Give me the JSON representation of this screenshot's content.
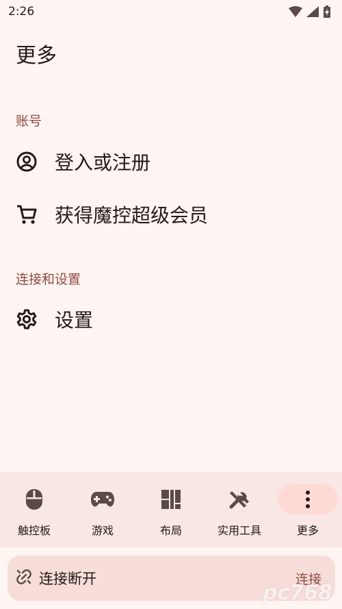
{
  "status_bar": {
    "time": "2:26"
  },
  "page": {
    "title": "更多"
  },
  "sections": {
    "account": {
      "header": "账号",
      "items": [
        {
          "label": "登入或注册",
          "icon": "account-circle-icon"
        },
        {
          "label": "获得魔控超级会员",
          "icon": "cart-icon"
        }
      ]
    },
    "connection": {
      "header": "连接和设置",
      "items": [
        {
          "label": "设置",
          "icon": "gear-icon"
        }
      ]
    }
  },
  "bottom_nav": {
    "items": [
      {
        "label": "触控板",
        "icon": "mouse-icon",
        "active": false
      },
      {
        "label": "游戏",
        "icon": "gamepad-icon",
        "active": false
      },
      {
        "label": "布局",
        "icon": "layout-icon",
        "active": false
      },
      {
        "label": "实用工具",
        "icon": "tools-icon",
        "active": false
      },
      {
        "label": "更多",
        "icon": "more-vert-icon",
        "active": true
      }
    ]
  },
  "connection_bar": {
    "status": "连接断开",
    "action_label": "连接",
    "icon": "link-off-icon"
  },
  "watermark": "pc768",
  "colors": {
    "background": "#fff5f2",
    "accent": "#904a43",
    "nav_background": "#f8e7e4",
    "active_pill": "#ffdad5"
  }
}
